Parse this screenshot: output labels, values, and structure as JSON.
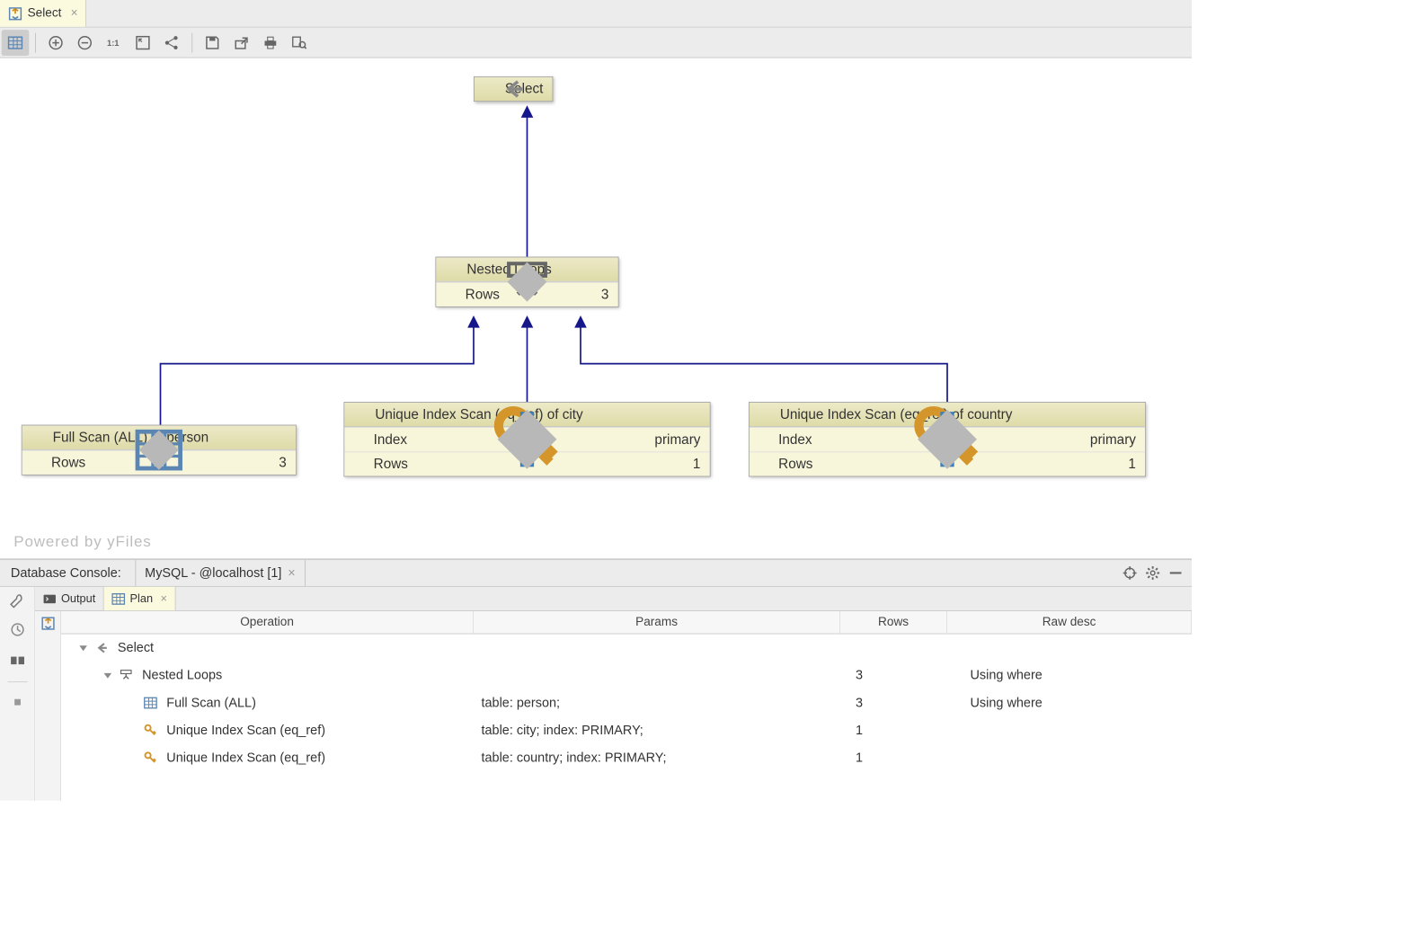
{
  "tab": {
    "label": "Select"
  },
  "diagram": {
    "watermark": "Powered by yFiles",
    "nodes": {
      "select": {
        "title": "Select"
      },
      "nested": {
        "title": "Nested Loops",
        "rows_label": "Rows",
        "rows_value": "3"
      },
      "person": {
        "title": "Full Scan (ALL) of person",
        "rows_label": "Rows",
        "rows_value": "3"
      },
      "city": {
        "title": "Unique Index Scan (eq_ref) of city",
        "index_label": "Index",
        "index_value": "primary",
        "rows_label": "Rows",
        "rows_value": "1"
      },
      "country": {
        "title": "Unique Index Scan (eq_ref) of country",
        "index_label": "Index",
        "index_value": "primary",
        "rows_label": "Rows",
        "rows_value": "1"
      }
    }
  },
  "console": {
    "title": "Database Console:",
    "connection": "MySQL - @localhost [1]",
    "subtabs": {
      "output": "Output",
      "plan": "Plan"
    },
    "columns": {
      "op": "Operation",
      "params": "Params",
      "rows": "Rows",
      "raw": "Raw desc"
    },
    "rows": [
      {
        "indent": 0,
        "disclosure": true,
        "icon": "arrow-left",
        "op": "Select",
        "params": "",
        "rows_n": "",
        "raw": ""
      },
      {
        "indent": 1,
        "disclosure": true,
        "icon": "nested",
        "op": "Nested Loops",
        "params": "",
        "rows_n": "3",
        "raw": "Using where"
      },
      {
        "indent": 2,
        "disclosure": false,
        "icon": "grid",
        "op": "Full Scan (ALL)",
        "params": "table: person;",
        "rows_n": "3",
        "raw": "Using where"
      },
      {
        "indent": 2,
        "disclosure": false,
        "icon": "key",
        "op": "Unique Index Scan (eq_ref)",
        "params": "table: city; index: PRIMARY;",
        "rows_n": "1",
        "raw": ""
      },
      {
        "indent": 2,
        "disclosure": false,
        "icon": "key",
        "op": "Unique Index Scan (eq_ref)",
        "params": "table: country; index: PRIMARY;",
        "rows_n": "1",
        "raw": ""
      }
    ]
  }
}
